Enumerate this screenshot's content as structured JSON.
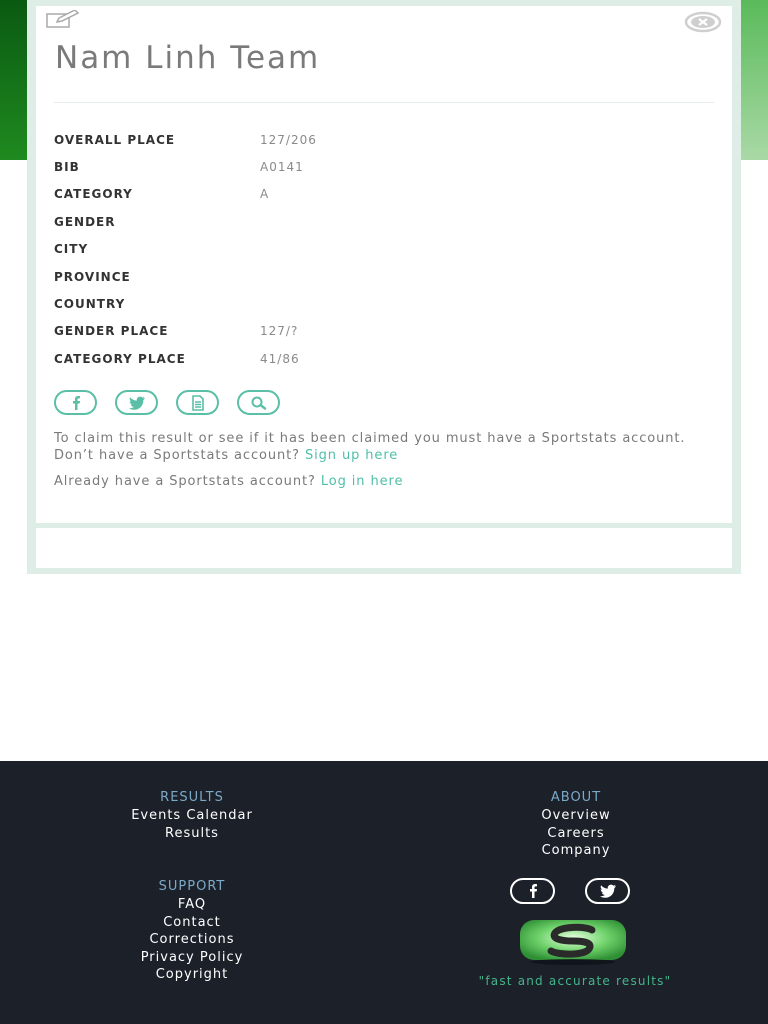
{
  "modal": {
    "title": "Nam Linh Team",
    "rows": [
      {
        "label": "OVERALL PLACE",
        "value": "127/206"
      },
      {
        "label": "BIB",
        "value": "A0141"
      },
      {
        "label": "CATEGORY",
        "value": "A"
      },
      {
        "label": "GENDER",
        "value": ""
      },
      {
        "label": "CITY",
        "value": ""
      },
      {
        "label": "PROVINCE",
        "value": ""
      },
      {
        "label": "COUNTRY",
        "value": ""
      },
      {
        "label": "GENDER PLACE",
        "value": "127/?"
      },
      {
        "label": "CATEGORY PLACE",
        "value": "41/86"
      }
    ],
    "share_icons": [
      "facebook-icon",
      "twitter-icon",
      "document-icon",
      "search-icon"
    ],
    "claim": {
      "text": "To claim this result or see if it has been claimed you must have a Sportstats account.",
      "signup_prompt": "Don’t have a Sportstats account?",
      "signup_link": "Sign up here",
      "login_prompt": "Already have a Sportstats account?",
      "login_link": "Log in here"
    },
    "edit_icon": "edit-icon",
    "close_icon": "close-icon"
  },
  "footer": {
    "results": {
      "heading": "RESULTS",
      "links": [
        "Events Calendar",
        "Results"
      ]
    },
    "support": {
      "heading": "SUPPORT",
      "links": [
        "FAQ",
        "Contact",
        "Corrections",
        "Privacy Policy",
        "Copyright"
      ]
    },
    "about": {
      "heading": "ABOUT",
      "links": [
        "Overview",
        "Careers",
        "Company"
      ]
    },
    "social_icons": [
      "facebook-icon",
      "twitter-icon"
    ],
    "logo_icon": "sportstats-logo",
    "tagline": "\"fast and accurate results\""
  },
  "colors": {
    "accent": "#4fbfa8",
    "footer_bg": "#1b2029",
    "footer_heading": "#7ba9c8",
    "tagline": "#44b58a"
  }
}
